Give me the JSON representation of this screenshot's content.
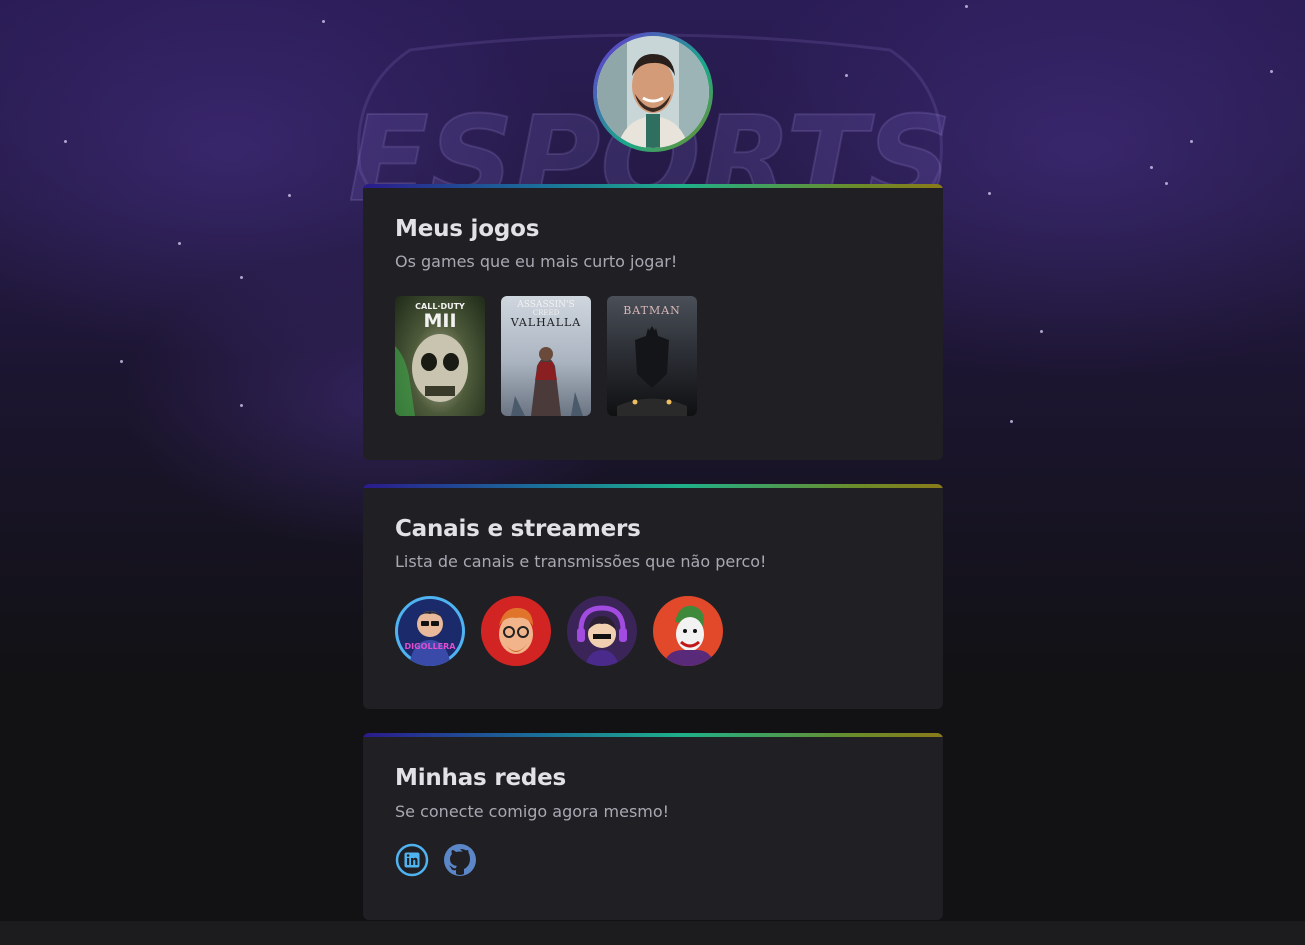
{
  "background": {
    "watermark_text": "ESPORTS"
  },
  "profile": {
    "avatar_alt": "profile-photo"
  },
  "games_card": {
    "title": "Meus jogos",
    "subtitle": "Os games que eu mais curto jogar!",
    "games": [
      {
        "name": "Call of Duty MWII",
        "logo_line1": "CALL·DUTY",
        "logo_line2": "MII"
      },
      {
        "name": "Assassin's Creed Valhalla",
        "logo_line1": "ASSASSIN'S",
        "logo_line2": "CREED",
        "logo_line3": "VALHALLA"
      },
      {
        "name": "Batman Arkham Knight",
        "logo_line1": "BATMAN"
      }
    ]
  },
  "streamers_card": {
    "title": "Canais e streamers",
    "subtitle": "Lista de canais e transmissões que não perco!",
    "streamers": [
      {
        "name": "Diego Llera",
        "badge_text": "DIGOLLERA",
        "color": "#2f6fd6"
      },
      {
        "name": "streamer-2",
        "color": "#d32424"
      },
      {
        "name": "streamer-3",
        "color": "#4a2a7a"
      },
      {
        "name": "streamer-4",
        "color": "#e2482a"
      }
    ]
  },
  "networks_card": {
    "title": "Minhas redes",
    "subtitle": "Se conecte comigo agora mesmo!",
    "links": [
      {
        "name": "linkedin-icon",
        "color": "#4fb3f0"
      },
      {
        "name": "github-icon",
        "color": "#5b86c8"
      }
    ]
  },
  "colors": {
    "page_bg": "#121214",
    "card_bg": "#202024",
    "title": "#e1e1e6",
    "subtitle": "#a8a8b3",
    "accent_gradient": [
      "#2a1a8c",
      "#1fb08a",
      "#8a7a1a"
    ]
  }
}
